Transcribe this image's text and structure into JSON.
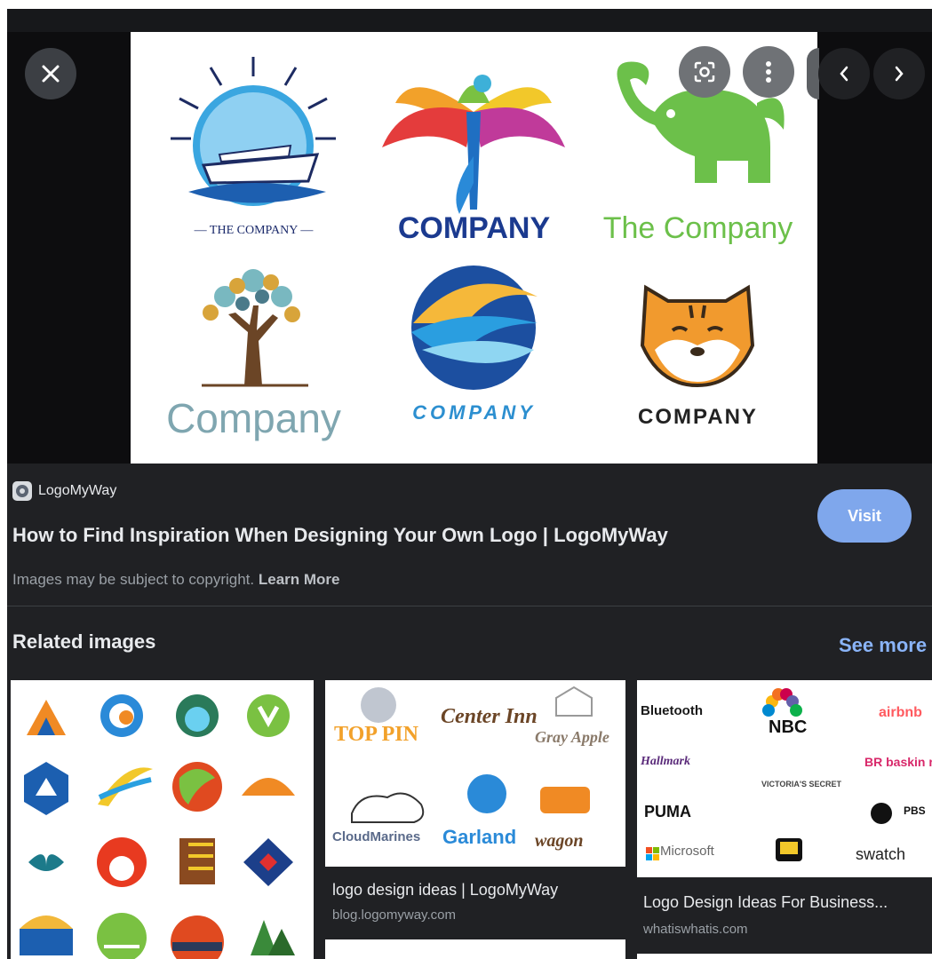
{
  "viewer": {
    "close_icon": "close-icon",
    "lens_icon": "google-lens-icon",
    "more_icon": "more-vertical-icon",
    "prev_icon": "chevron-left-icon",
    "next_icon": "chevron-right-icon",
    "logos": [
      {
        "caption": "— THE COMPANY —",
        "color": "#1b2a6b"
      },
      {
        "caption": "COMPANY",
        "color": "#1b3a8f"
      },
      {
        "caption": "The Company",
        "color": "#6cc04a"
      },
      {
        "caption": "Company",
        "color": "#7fa6b0"
      },
      {
        "caption": "COMPANY",
        "color": "#2c8fd0"
      },
      {
        "caption": "COMPANY",
        "color": "#222222"
      }
    ]
  },
  "source": {
    "name": "LogoMyWay",
    "title": "How to Find Inspiration When Designing Your Own Logo | LogoMyWay",
    "copyright_text": "Images may be subject to copyright.",
    "learn_more": "Learn More",
    "visit_label": "Visit"
  },
  "related": {
    "heading": "Related images",
    "see_more": "See more",
    "cards": [
      {
        "title": "",
        "domain": ""
      },
      {
        "title": "logo design ideas | LogoMyWay",
        "domain": "blog.logomyway.com",
        "logos": [
          "TOP PIN",
          "Center Inn",
          "Gray Apple",
          "CloudMarines",
          "Garland",
          "wagon"
        ]
      },
      {
        "title": "Logo Design Ideas For Business...",
        "domain": "whatiswhatis.com",
        "logos": [
          "Bluetooth",
          "NBC",
          "airbnb",
          "Hallmark",
          "VICTORIA'S SECRET",
          "BR baskin robbins",
          "PUMA",
          "PBS",
          "Microsoft",
          "swatch"
        ]
      }
    ]
  },
  "colors": {
    "panel_bg": "#202124",
    "accent_link": "#8ab4f8",
    "visit_bg": "#7fa7ec"
  }
}
